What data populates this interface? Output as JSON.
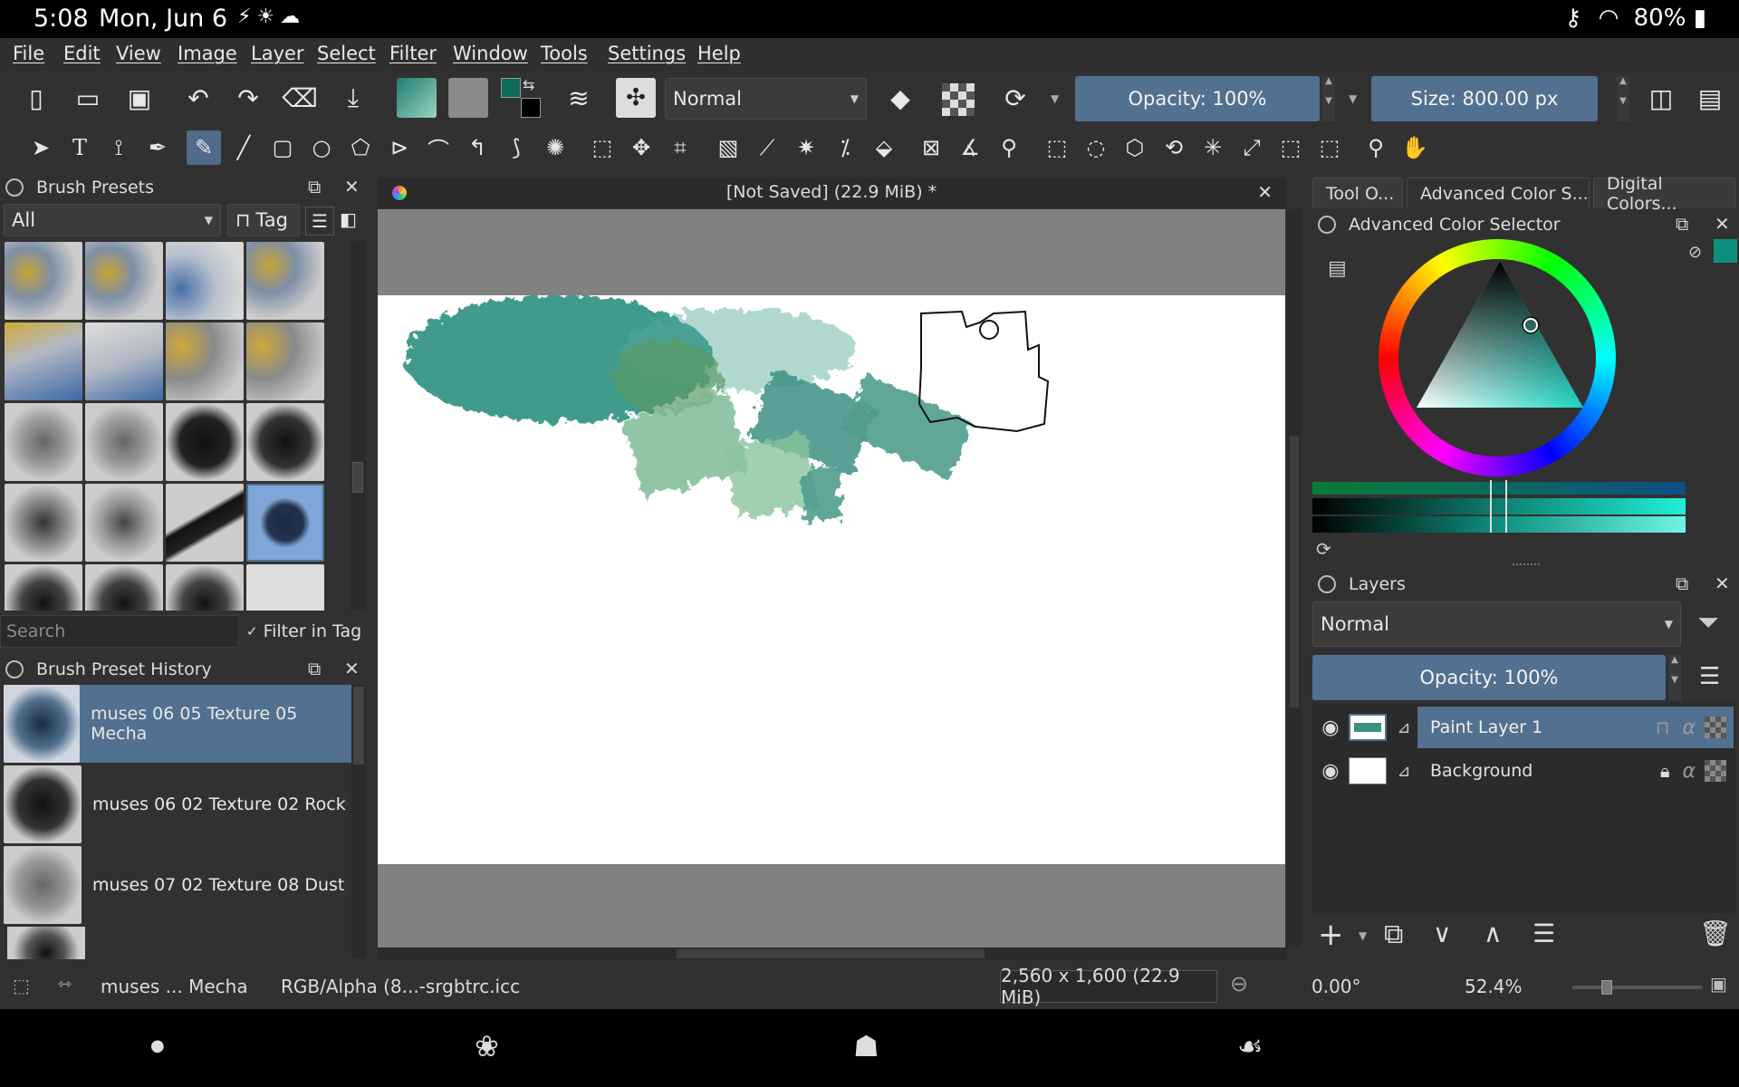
{
  "status_bar": {
    "time": "5:08",
    "date": "Mon, Jun 6",
    "battery": "80%"
  },
  "menu": [
    "File",
    "Edit",
    "View",
    "Image",
    "Layer",
    "Select",
    "Filter",
    "Window",
    "Tools",
    "Settings",
    "Help"
  ],
  "toolbar": {
    "blend_mode": "Normal",
    "opacity": "Opacity: 100%",
    "size": "Size: 800.00 px",
    "fg_color": "#0e6b5e",
    "bg_color": "#000000"
  },
  "brush_presets": {
    "title": "Brush Presets",
    "filter": "All",
    "tag_button": "Tag",
    "search_placeholder": "Search",
    "filter_in_tag": "Filter in Tag"
  },
  "brush_history": {
    "title": "Brush Preset History",
    "items": [
      "muses 06 05 Texture 05 Mecha",
      "muses 06 02 Texture 02 Rock",
      "muses 07 02 Texture 08 Dust"
    ]
  },
  "document": {
    "tab_title": "[Not Saved]  (22.9 MiB)  *"
  },
  "right_tabs": [
    "Tool O...",
    "Advanced Color S...",
    "Digital Colors..."
  ],
  "color_selector": {
    "title": "Advanced Color Selector",
    "accent": "#0e8f7e"
  },
  "layers": {
    "title": "Layers",
    "blend_mode": "Normal",
    "opacity": "Opacity:  100%",
    "items": [
      {
        "name": "Paint Layer 1"
      },
      {
        "name": "Background"
      }
    ]
  },
  "status": {
    "brush": "muses ... Mecha",
    "color_profile": "RGB/Alpha (8...-srgbtrc.icc",
    "image_size": "2,560 x 1,600 (22.9 MiB)",
    "rotation": "0.00°",
    "zoom": "52.4%"
  }
}
